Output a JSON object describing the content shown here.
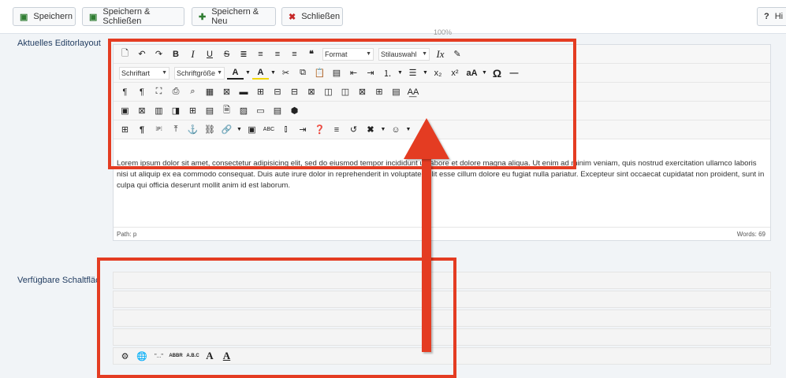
{
  "toolbar": {
    "save": "Speichern",
    "save_close": "Speichern & Schließen",
    "save_new": "Speichern & Neu",
    "close": "Schließen",
    "help": "Hi"
  },
  "zoom_label": "100%",
  "labels": {
    "current_layout": "Aktuelles Editorlayout",
    "available_buttons": "Verfügbare Schaltflächen"
  },
  "editor": {
    "format_select": "Format",
    "style_select": "Stilauswahl",
    "font_select": "Schriftart",
    "size_select": "Schriftgröße",
    "body_text": "Lorem ipsum dolor sit amet, consectetur adipisicing elit, sed do eiusmod tempor incididunt ut labore et dolore magna aliqua. Ut enim ad minim veniam, quis nostrud exercitation ullamco laboris nisi ut aliquip ex ea commodo consequat. Duis aute irure dolor in reprehenderit in voluptate velit esse cillum dolore eu fugiat nulla pariatur. Excepteur sint occaecat cupidatat non proident, sunt in culpa qui officia deserunt mollit anim id est laborum.",
    "path_label": "Path:",
    "path_value": "p",
    "words": "Words: 69"
  },
  "highlight_color": "#e43c22"
}
